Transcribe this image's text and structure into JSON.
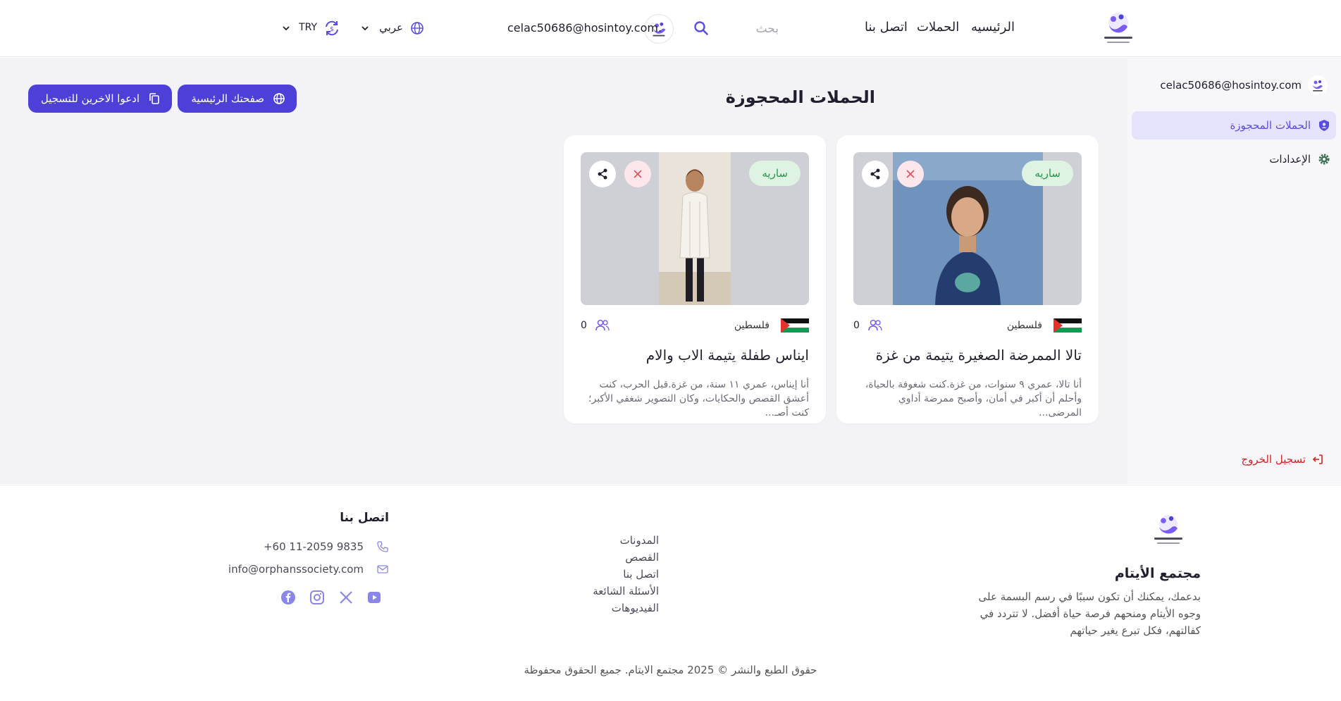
{
  "colors": {
    "accent": "#4d40d9",
    "accent_light": "#e5e3fb",
    "status_green": "#23964a",
    "status_green_bg": "#dff3e2",
    "danger": "#d32020",
    "icon_purple": "#7b5cf0"
  },
  "header": {
    "nav": {
      "home": "الرئيسيه",
      "campaigns": "الحملات",
      "contact": "اتصل بنا"
    },
    "search": {
      "placeholder": "بحث",
      "icon": "search-icon"
    },
    "user_email": "celac50686@hosintoy.com.",
    "language": {
      "label": "عربي",
      "icon": "globe-icon"
    },
    "currency": {
      "label": "TRY",
      "icon": "currency-exchange-icon"
    }
  },
  "sidebar": {
    "user_email": "celac50686@hosintoy.com",
    "items": [
      {
        "label": "الحملات المحجوزة",
        "icon": "user-shield-icon"
      },
      {
        "label": "الإعدادات",
        "icon": "gear-icon"
      }
    ],
    "logout": {
      "label": "تسجيل الخروج",
      "icon": "logout-icon"
    }
  },
  "main": {
    "title": "الحملات المحجوزة",
    "buttons": {
      "home_page": {
        "label": "صفحتك الرئيسية",
        "icon": "globe-icon"
      },
      "invite": {
        "label": "ادعوا الاخرين للتسجيل",
        "icon": "copy-icon"
      }
    },
    "cards": [
      {
        "status": "ساريه",
        "country": "فلسطين",
        "supporters": "0",
        "title": "تالا الممرضة الصغيرة يتيمة من غزة",
        "description": "أنا تالا، عمري ٩ سنوات، من غزة.كنت شغوفة بالحياة، وأحلم أن أكبر في أمان، وأصبح ممرضة أداوي المرضى..."
      },
      {
        "status": "ساريه",
        "country": "فلسطين",
        "supporters": "0",
        "title": "ايناس طفلة يتيمة الاب والام",
        "description": "أنا إيناس، عمري ١١ سنة، من غزة.قبل الحرب، كنت أعشق القصص والحكايات، وكان التصوير شغفي الأكبر؛ كنت أصـ..."
      }
    ]
  },
  "footer": {
    "org_name": "مجتمع الأيتام",
    "about": "بدعمك، يمكنك أن تكون سببًا في رسم البسمة على وجوه الأيتام ومنحهم فرصة حياة أفضل. لا تتردد في كفالتهم، فكل تبرع يغير حياتهم",
    "links": [
      "المدونات",
      "القصص",
      "اتصل بنا",
      "الأسئلة الشائعة",
      "الفيديوهات"
    ],
    "contact": {
      "title": "اتصل بنا",
      "phone": "+60 11-2059 9835",
      "email": "info@orphanssociety.com"
    },
    "socials": [
      "facebook-icon",
      "instagram-icon",
      "x-icon",
      "youtube-icon"
    ],
    "copyright": "حقوق الطبع والنشر © 2025 مجتمع الايتام. جميع الحقوق محفوظة"
  }
}
